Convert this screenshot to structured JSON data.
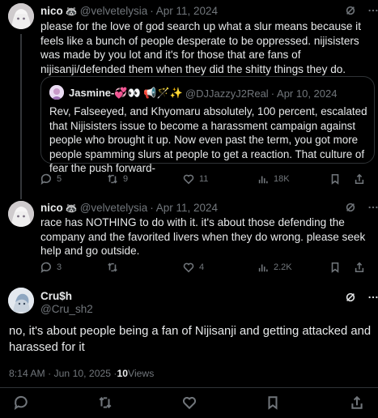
{
  "post1": {
    "name": "nico",
    "handle": "@velvetelysia",
    "separator": "·",
    "date": "Apr 11, 2024",
    "text": "please for the love of god search up what a slur means because it feels like a bunch of people desperate to be oppressed. nijisisters was made by you lot and it's for those that are fans of nijisanji/defended them when they did the shitty things they do.",
    "quote": {
      "name": "Jasmine-💞👀 📢🪄✨",
      "handle": "@DJJazzyJ2Real",
      "separator": "·",
      "date": "Apr 10, 2024",
      "text": "Rev, Falseeyed, and Khyomaru absolutely, 100 percent, escalated that Nijisisters issue to become a harassment campaign against people who brought it up. Now even past the term, you got more people spamming slurs at people to get a reaction. That culture of fear the push forward-"
    },
    "stats": {
      "replies": "5",
      "reposts": "9",
      "likes": "11",
      "views": "18K"
    }
  },
  "post2": {
    "name": "nico",
    "handle": "@velvetelysia",
    "separator": "·",
    "date": "Apr 11, 2024",
    "text": "race has NOTHING to do with it. it's about those defending the company and the favorited livers when they do wrong. please seek help and go outside.",
    "stats": {
      "replies": "3",
      "reposts": "",
      "likes": "4",
      "views": "2.2K"
    }
  },
  "main": {
    "name": "Cru$h",
    "handle": "@Cru_sh2",
    "text": "no, it's about people being a fan of Nijisanji and getting attacked and harassed for it",
    "time": "8:14 AM · Jun 10, 2025 · ",
    "views_count": "10",
    "views_label": " Views"
  },
  "colors": {
    "background": "#000000",
    "text": "#e7e9ea",
    "muted": "#71767b",
    "border": "#2f3336"
  }
}
